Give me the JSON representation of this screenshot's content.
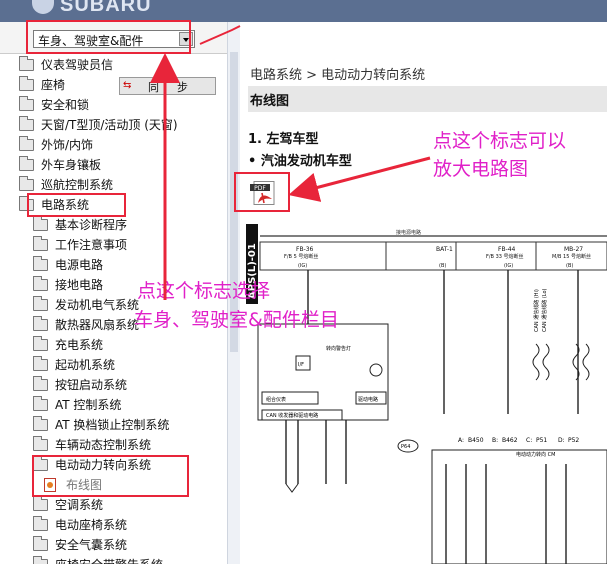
{
  "app": {
    "brand": "SUBARU"
  },
  "category_select": {
    "value": "车身、驾驶室&配件"
  },
  "sync_button": {
    "label": "同步"
  },
  "tree": {
    "items": [
      {
        "label": "仪表驾驶员信"
      },
      {
        "label": "座椅"
      },
      {
        "label": "安全和锁"
      },
      {
        "label": "天窗/T型顶/活动顶 (天窗)"
      },
      {
        "label": "外饰/内饰"
      },
      {
        "label": "外车身镶板"
      },
      {
        "label": "巡航控制系统"
      },
      {
        "label": "电路系统"
      },
      {
        "label": "基本诊断程序"
      },
      {
        "label": "工作注意事项"
      },
      {
        "label": "电源电路"
      },
      {
        "label": "接地电路"
      },
      {
        "label": "发动机电气系统"
      },
      {
        "label": "散热器风扇系统"
      },
      {
        "label": "充电系统"
      },
      {
        "label": "起动机系统"
      },
      {
        "label": "按钮启动系统"
      },
      {
        "label": "AT 控制系统"
      },
      {
        "label": "AT 换档锁止控制系统"
      },
      {
        "label": "车辆动态控制系统"
      },
      {
        "label": "电动动力转向系统"
      },
      {
        "label": "布线图"
      },
      {
        "label": "空调系统"
      },
      {
        "label": "电动座椅系统"
      },
      {
        "label": "安全气囊系统"
      },
      {
        "label": "座椅安全带警告系统"
      }
    ]
  },
  "content": {
    "breadcrumb": "电路系统 > 电动动力转向系统",
    "section_title": "布线图",
    "subtitle1": "1. 左驾车型",
    "subtitle2": "• 汽油发动机车型",
    "pdf_label": "PDF"
  },
  "diagram": {
    "side_label": "APS(L)-01",
    "top_label": "接电源电路",
    "fuses": [
      {
        "name": "FB-36",
        "spec": "F/B 5 号熔断丝",
        "tag": "(IG)"
      },
      {
        "name": "BAT-1",
        "spec": "",
        "tag": "(B)"
      },
      {
        "name": "FB-44",
        "spec": "F/B 33 号熔断丝",
        "tag": "(IG)"
      },
      {
        "name": "MB-27",
        "spec": "M/B 15 号熔断丝",
        "tag": "(B)"
      }
    ],
    "meter_labels": {
      "if": "I/F",
      "warning": "转向警告灯",
      "cpu": "组合仪表",
      "can": "CAN 收发器和驱动电路",
      "backlight": "驱动电路"
    },
    "connectors": [
      "A:",
      "B450",
      "B:",
      "B462",
      "C:",
      "P51",
      "D:",
      "P52"
    ],
    "p64": "P64",
    "ecu_label": "电动动力转向 CM",
    "can_labels": [
      "CAN 通信线路 (Hi)",
      "CAN 通信线路 (Lo)"
    ]
  },
  "annotations": {
    "zoom_hint_line1": "点这个标志可以",
    "zoom_hint_line2": "放大电路图",
    "select_hint_line1": "点这个标志选择",
    "select_hint_line2": "车身、驾驶室&配件栏目"
  },
  "colors": {
    "annotation": "#e020c8",
    "highlight_box": "#e8253a",
    "header": "#5b6f91"
  }
}
